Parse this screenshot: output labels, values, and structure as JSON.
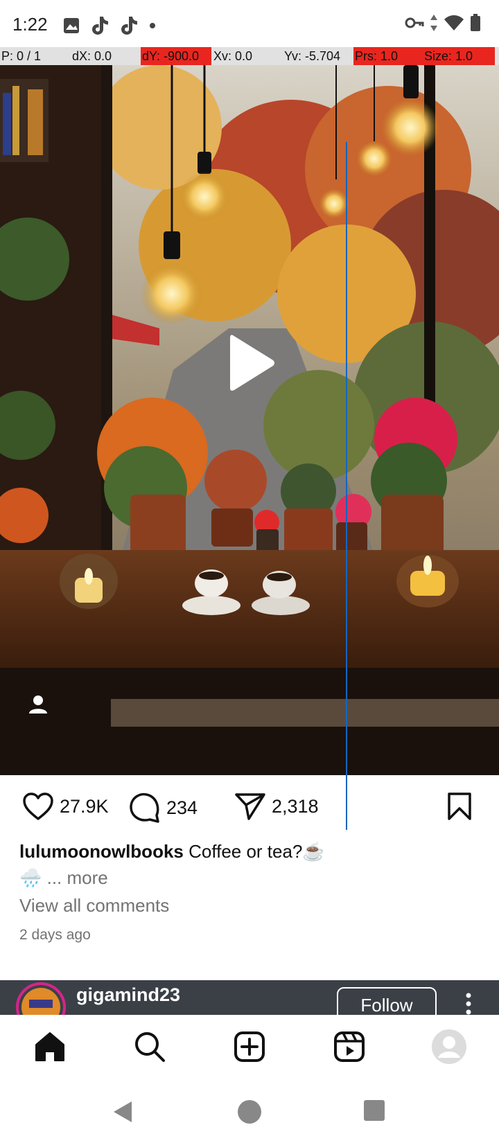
{
  "status_bar": {
    "time": "1:22"
  },
  "debug_overlay": {
    "pointers": "P: 0 / 1",
    "dx": "dX: 0.0",
    "dy": "dY: -900.0",
    "xv": "Xv: 0.0",
    "yv": "Yv: -5.704",
    "prs": "Prs: 1.0",
    "size": "Size: 1.0",
    "highlight_color": "#e8261f",
    "pointer_line_color": "#1565c0"
  },
  "post": {
    "media_type": "video",
    "likes": "27.9K",
    "comments_count": "234",
    "shares": "2,318",
    "username": "lulumoonowlbooks",
    "caption": "Coffee or tea?☕️",
    "caption_line2": "🌧️",
    "more_label": "... more",
    "view_comments": "View all comments",
    "timestamp": "2 days ago"
  },
  "next_post": {
    "username": "gigamind23",
    "follow_label": "Follow"
  },
  "bottom_nav": {
    "items": [
      "home-icon",
      "search-icon",
      "create-icon",
      "reels-icon",
      "profile-icon"
    ],
    "active": "home"
  },
  "system_nav": {
    "buttons": [
      "back",
      "home",
      "recents"
    ]
  }
}
